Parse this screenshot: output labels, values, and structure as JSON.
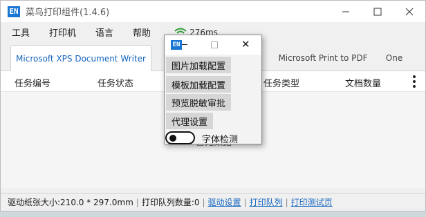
{
  "window": {
    "title": "菜鸟打印组件(1.4.6)",
    "icon_text": "EN",
    "controls": [
      "minimize-icon",
      "maximize-icon",
      "close-icon"
    ]
  },
  "menu": {
    "items": [
      "工具",
      "打印机",
      "语言",
      "帮助"
    ],
    "latency": "276ms",
    "latency_icon": "wifi-icon",
    "latency_color": "#2e9e3a"
  },
  "tabs": [
    {
      "label": "Microsoft XPS Document Writer",
      "active": true
    },
    {
      "label": "Microsoft Print to PDF",
      "active": false
    },
    {
      "label": "One",
      "active": false
    }
  ],
  "table": {
    "columns": [
      "任务编号",
      "任务状态",
      "任务类型",
      "文档数量"
    ],
    "empty_text": "暂无数据"
  },
  "status": {
    "paper_size": "驱动纸张大小:210.0 * 297.0mm",
    "queue_count": "打印队列数量:0",
    "links": [
      "驱动设置",
      "打印队列",
      "打印测试页"
    ]
  },
  "popup": {
    "icon_text": "EN",
    "buttons": [
      "图片加载配置",
      "模板加载配置",
      "预览脱敏审批",
      "代理设置"
    ],
    "toggle_label": "字体检测",
    "toggle_on": false
  },
  "colors": {
    "accent": "#1565c0",
    "brand_icon": "#1976d2"
  }
}
